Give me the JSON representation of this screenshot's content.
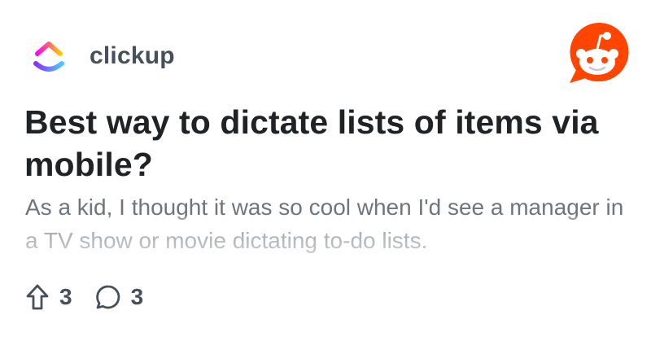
{
  "community": {
    "name": "clickup",
    "icon": "clickup-logo-icon"
  },
  "brand": {
    "icon": "reddit-logo-icon",
    "accent": "#ff4500"
  },
  "post": {
    "title": "Best way to dictate lists of items via mobile?",
    "excerpt": "As a kid, I thought it was so cool when I'd see a manager in a TV show or movie dictating to-do lists.",
    "upvotes": "3",
    "comments": "3"
  },
  "colors": {
    "title": "#1f2326",
    "excerpt": "#6e757b",
    "meta": "#46505a"
  }
}
